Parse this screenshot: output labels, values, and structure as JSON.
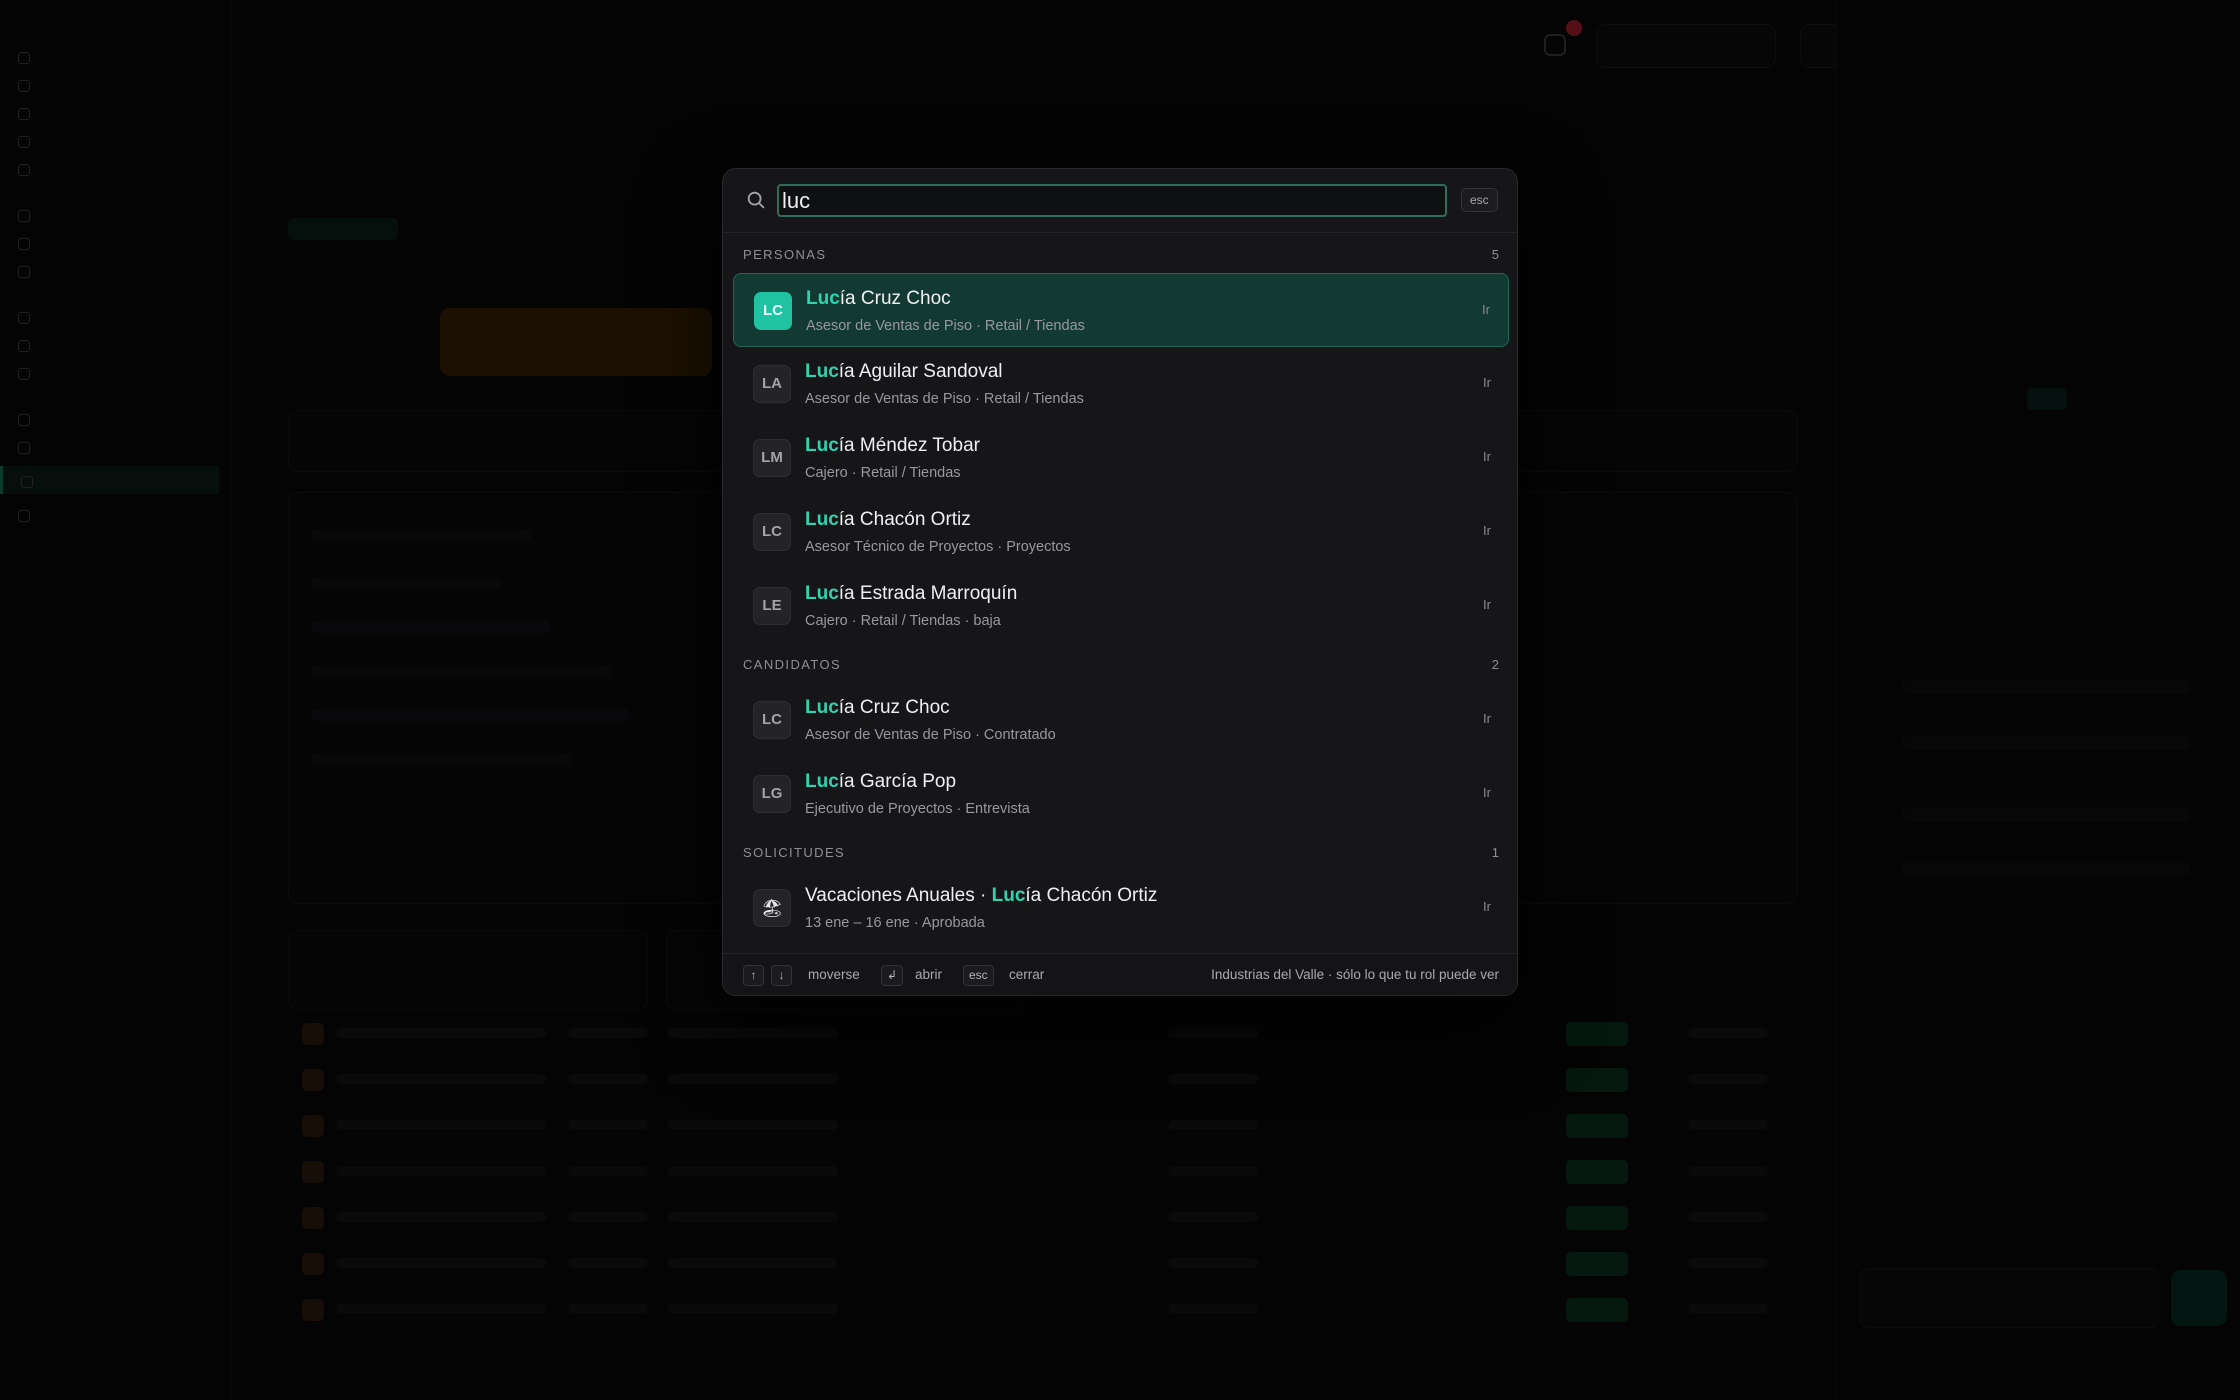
{
  "search": {
    "value": "luc",
    "esc_label": "esc"
  },
  "groups": {
    "personas": {
      "label": "PERSONAS",
      "count": "5",
      "items": [
        {
          "initials": "LC",
          "match": "Luc",
          "rest": "ía Cruz Choc",
          "sub": "Asesor de Ventas de Piso · Retail / Tiendas",
          "go": "Ir"
        },
        {
          "initials": "LA",
          "match": "Luc",
          "rest": "ía Aguilar Sandoval",
          "sub": "Asesor de Ventas de Piso · Retail / Tiendas",
          "go": "Ir"
        },
        {
          "initials": "LM",
          "match": "Luc",
          "rest": "ía Méndez Tobar",
          "sub": "Cajero · Retail / Tiendas",
          "go": "Ir"
        },
        {
          "initials": "LC",
          "match": "Luc",
          "rest": "ía Chacón Ortiz",
          "sub": "Asesor Técnico de Proyectos · Proyectos",
          "go": "Ir"
        },
        {
          "initials": "LE",
          "match": "Luc",
          "rest": "ía Estrada Marroquín",
          "sub": "Cajero · Retail / Tiendas · baja",
          "go": "Ir"
        }
      ]
    },
    "candidatos": {
      "label": "CANDIDATOS",
      "count": "2",
      "items": [
        {
          "initials": "LC",
          "match": "Luc",
          "rest": "ía Cruz Choc",
          "sub": "Asesor de Ventas de Piso · Contratado",
          "go": "Ir"
        },
        {
          "initials": "LG",
          "match": "Luc",
          "rest": "ía García Pop",
          "sub": "Ejecutivo de Proyectos · Entrevista",
          "go": "Ir"
        }
      ]
    },
    "solicitudes": {
      "label": "SOLICITUDES",
      "count": "1",
      "items": [
        {
          "icon": "🏖",
          "prefix": "Vacaciones Anuales · ",
          "match": "Luc",
          "rest": "ía Chacón Ortiz",
          "sub": "13 ene – 16 ene · Aprobada",
          "go": "Ir"
        }
      ]
    }
  },
  "footer": {
    "up_key": "↑",
    "down_key": "↓",
    "move_label": "moverse",
    "enter_key": "↲",
    "open_label": "abrir",
    "esc_key": "esc",
    "close_label": "cerrar",
    "scope_note": "Industrias del Valle · sólo lo que tu rol puede ver"
  },
  "colors": {
    "accent": "#2fd3b0",
    "selected_bg": "#123a33",
    "palette_bg": "#161618"
  }
}
